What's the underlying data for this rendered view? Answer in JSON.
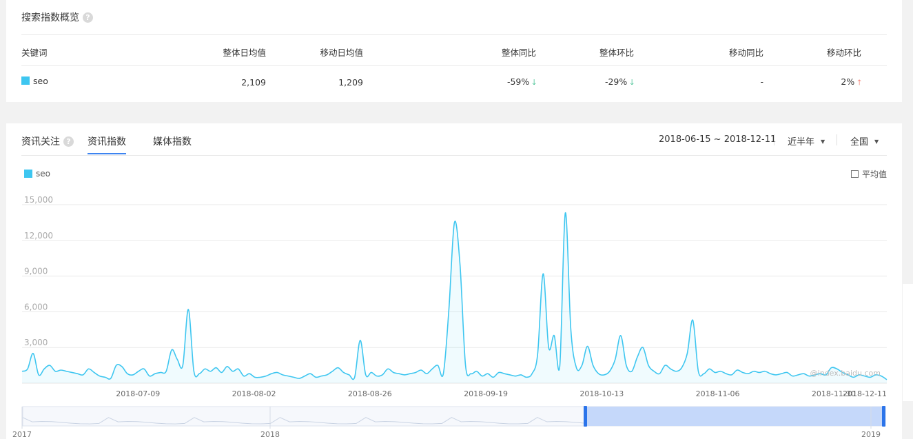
{
  "overview": {
    "title": "搜索指数概览",
    "headers": [
      "关键词",
      "整体日均值",
      "移动日均值",
      "整体同比",
      "整体环比",
      "移动同比",
      "移动环比"
    ],
    "row": {
      "keyword": "seo",
      "overall_daily_avg": "2,109",
      "mobile_daily_avg": "1,209",
      "overall_yoy": "-59%",
      "overall_mom": "-29%",
      "mobile_yoy": "-",
      "mobile_mom": "2%"
    },
    "colors": {
      "keyword": "#3ec6f0",
      "down": "#1fb47d",
      "up": "#f2695d"
    }
  },
  "news": {
    "section_label": "资讯关注",
    "tabs": [
      {
        "label": "资讯指数",
        "active": true
      },
      {
        "label": "媒体指数",
        "active": false
      }
    ],
    "date_range": "2018-06-15 ~ 2018-12-11",
    "period": "近半年",
    "region": "全国",
    "avg_label": "平均值",
    "watermark": "@index.baidu.com"
  },
  "chart_data": {
    "type": "area",
    "series": [
      {
        "name": "seo",
        "color": "#3ec6f0",
        "values": [
          1000,
          1200,
          2500,
          700,
          1200,
          1500,
          1000,
          1100,
          1000,
          900,
          800,
          700,
          1200,
          900,
          600,
          500,
          400,
          1500,
          1400,
          800,
          700,
          1000,
          1200,
          600,
          800,
          900,
          1000,
          2800,
          2000,
          1500,
          6200,
          1000,
          800,
          1200,
          1000,
          1300,
          900,
          1400,
          1000,
          1200,
          600,
          800,
          500,
          500,
          600,
          800,
          900,
          700,
          600,
          500,
          400,
          600,
          800,
          500,
          600,
          700,
          1000,
          1300,
          900,
          700,
          500,
          3600,
          700,
          900,
          600,
          700,
          1200,
          900,
          800,
          700,
          800,
          900,
          1100,
          800,
          1200,
          1500,
          800,
          6200,
          13500,
          10000,
          1500,
          800,
          1000,
          600,
          800,
          500,
          900,
          800,
          700,
          600,
          700,
          500,
          800,
          2400,
          9200,
          3000,
          4000,
          1400,
          14300,
          4500,
          1300,
          1500,
          3100,
          1500,
          800,
          700,
          1000,
          2000,
          4000,
          1500,
          1000,
          2200,
          3000,
          1500,
          1000,
          800,
          1500,
          1200,
          1000,
          1300,
          2500,
          5300,
          1000,
          800,
          1200,
          900,
          1000,
          800,
          700,
          1100,
          900,
          800,
          1000,
          900,
          1000,
          800,
          700,
          800,
          900,
          600,
          700,
          800,
          600,
          700,
          800,
          700,
          1300,
          1200,
          900,
          700,
          500,
          700,
          600,
          500,
          700,
          600,
          300
        ]
      }
    ],
    "x_range": [
      "2018-06-15",
      "2018-12-11"
    ],
    "x_tick_labels": [
      "2018-07-09",
      "2018-08-02",
      "2018-08-26",
      "2018-09-19",
      "2018-10-13",
      "2018-11-06",
      "2018-11-30",
      "2018-12-11"
    ],
    "y_tick_labels": [
      "3,000",
      "6,000",
      "9,000",
      "12,000",
      "15,000"
    ],
    "y_ticks": [
      3000,
      6000,
      9000,
      12000,
      15000
    ],
    "ylim": [
      0,
      15000
    ],
    "grid": true,
    "legend": "top-left",
    "navigator": {
      "labels": [
        "2017",
        "2018",
        "2019"
      ],
      "selection": [
        "2018-06-15",
        "2018-12-11"
      ]
    }
  }
}
